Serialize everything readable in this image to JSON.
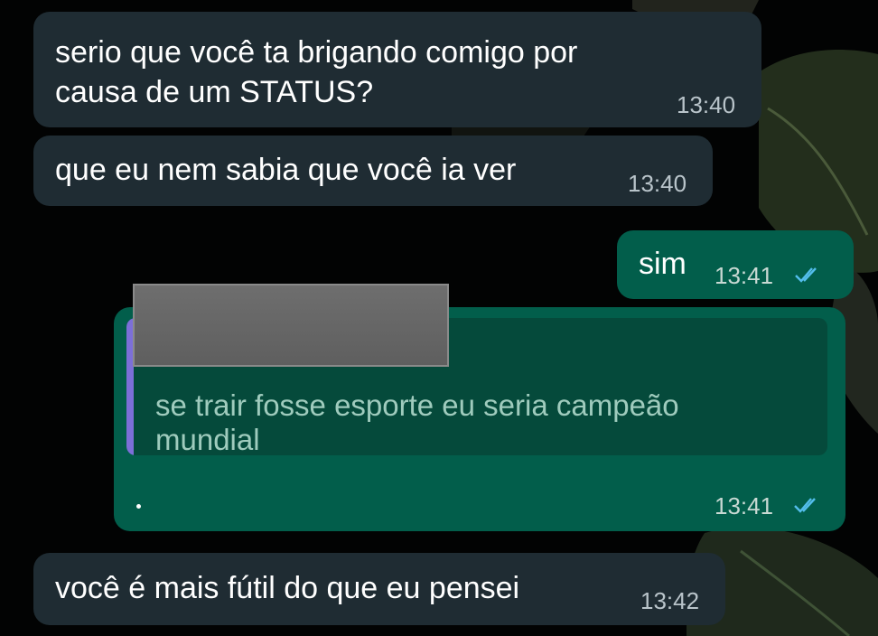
{
  "messages": [
    {
      "text_line1": "serio que você ta brigando comigo por",
      "text_line2": "causa de um STATUS?",
      "time": "13:40"
    },
    {
      "text": "que eu nem sabia que você ia ver",
      "time": "13:40"
    },
    {
      "text": "sim",
      "time": "13:41"
    },
    {
      "quote_line1": "se trair fosse esporte eu seria campeão",
      "quote_line2": "mundial",
      "time": "13:41"
    },
    {
      "text": "você é mais fútil do que eu pensei",
      "time": "13:42"
    }
  ],
  "colors": {
    "incoming_bubble": "#1f2c33",
    "outgoing_bubble": "#025e4b",
    "quote_bar": "#7c6fd8",
    "read_ticks": "#53bdeb"
  },
  "icons": {
    "read_receipt": "double-check-icon",
    "redaction": "gray-redaction-block"
  }
}
